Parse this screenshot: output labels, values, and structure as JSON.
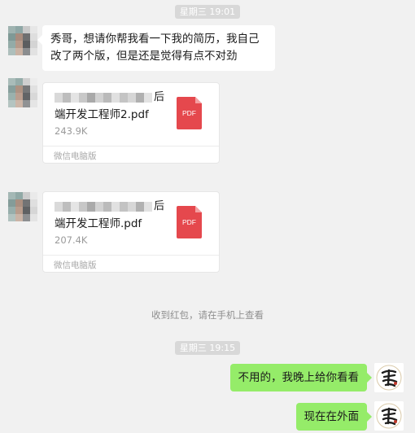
{
  "timestamps": [
    "星期三 19:01",
    "星期三 19:15"
  ],
  "messages": {
    "text_in": "秀哥，想请你帮我看一下我的简历，我自己改了两个版，但是还是觉得有点不对劲",
    "file1": {
      "name_visible_tail": "后",
      "name_line2": "端开发工程师2.pdf",
      "size": "243.9K",
      "icon_label": "PDF",
      "source": "微信电脑版"
    },
    "file2": {
      "name_visible_tail": "后",
      "name_line2": "端开发工程师.pdf",
      "size": "207.4K",
      "icon_label": "PDF",
      "source": "微信电脑版"
    },
    "system_notice": "收到红包，请在手机上查看",
    "out1": "不用的，我晚上给你看看",
    "out2": "现在在外面"
  },
  "colors": {
    "background": "#f1f1f1",
    "bubble_out": "#95ec69",
    "bubble_in": "#ffffff",
    "pdf_red": "#e5484d"
  },
  "icons": [
    "contact-avatar-pixelated",
    "pdf-file-icon",
    "self-avatar-calligraphy"
  ]
}
